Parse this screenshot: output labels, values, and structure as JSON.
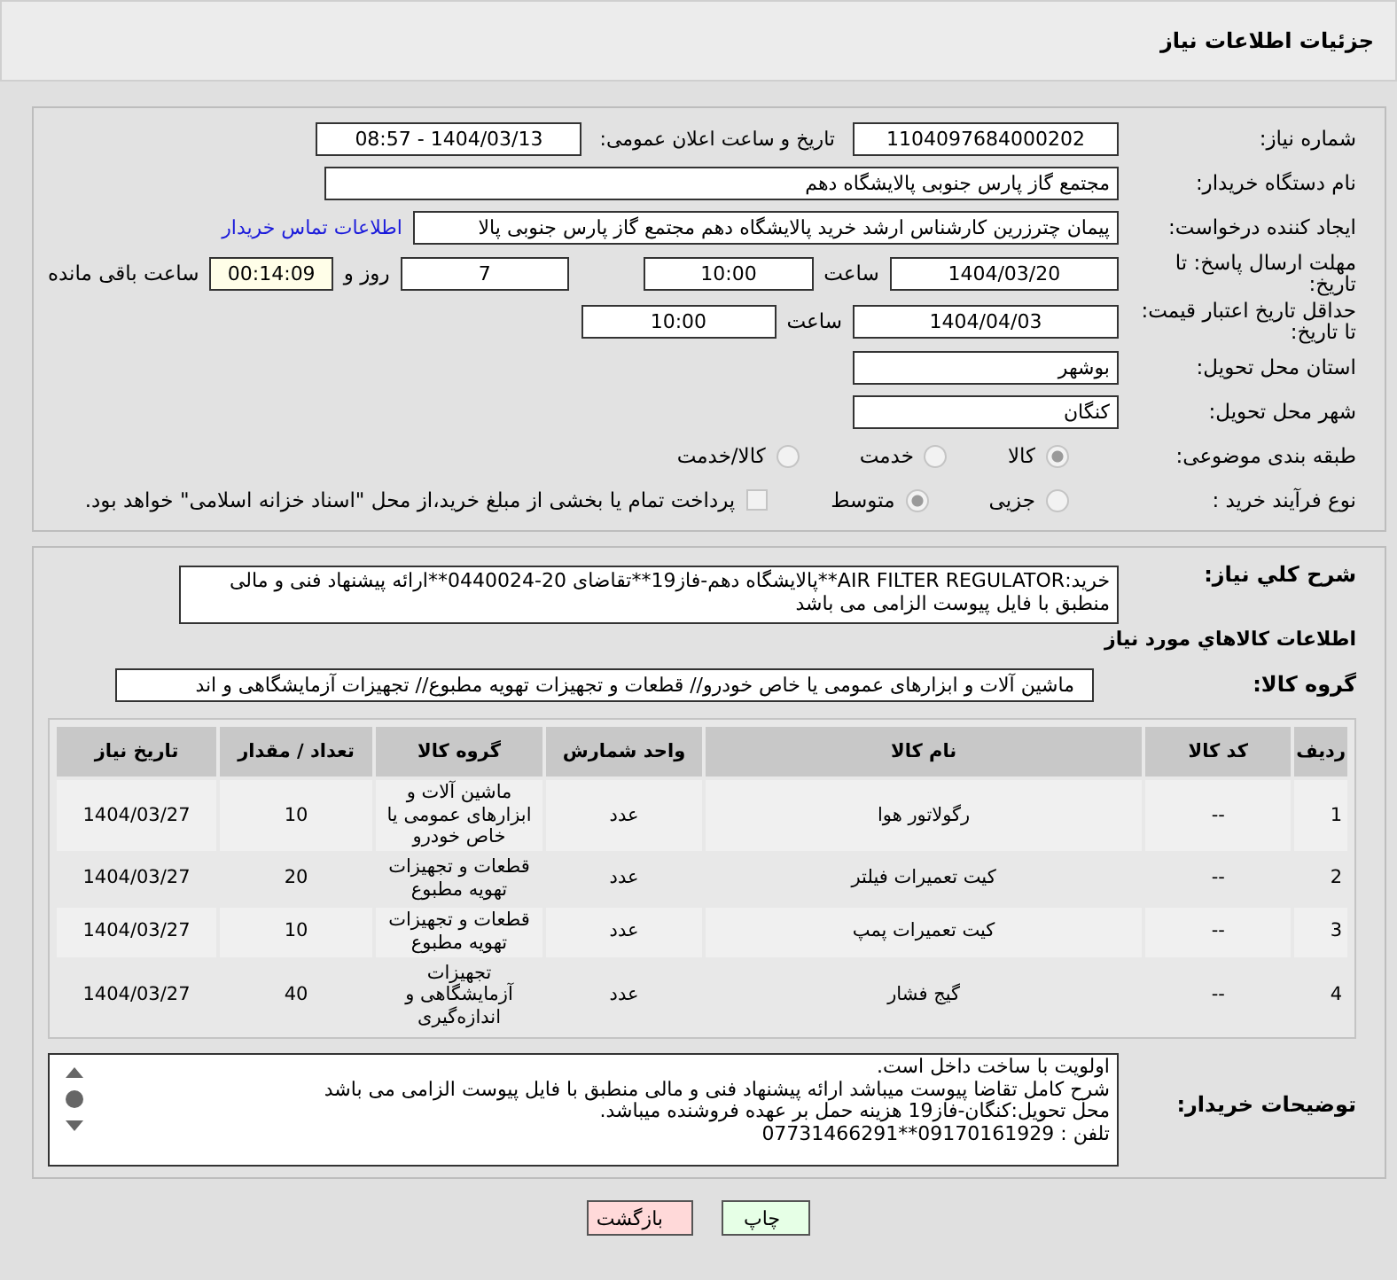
{
  "header": {
    "title": "جزئیات اطلاعات نیاز"
  },
  "need_number": {
    "label": "شماره نیاز:",
    "value": "1104097684000202"
  },
  "announce": {
    "label": "تاریخ و ساعت اعلان عمومی:",
    "value": "1404/03/13 - 08:57"
  },
  "buyer_org": {
    "label": "نام دستگاه خریدار:",
    "value": "مجتمع گاز پارس جنوبی  پالایشگاه دهم"
  },
  "requester": {
    "label": "ایجاد کننده درخواست:",
    "value": "پیمان چترزرین کارشناس ارشد خرید پالایشگاه دهم مجتمع گاز پارس جنوبی  پالا",
    "link": "اطلاعات تماس خریدار"
  },
  "reply_deadline": {
    "label": "مهلت ارسال پاسخ: تا تاریخ:",
    "date": "1404/03/20",
    "time_label": "ساعت",
    "time": "10:00",
    "days": "7",
    "days_label": "روز و",
    "remaining": "00:14:09",
    "remaining_label": "ساعت باقی مانده"
  },
  "price_validity": {
    "label": "حداقل تاریخ اعتبار قیمت: تا تاریخ:",
    "date": "1404/04/03",
    "time_label": "ساعت",
    "time": "10:00"
  },
  "province": {
    "label": "استان محل تحویل:",
    "value": "بوشهر"
  },
  "city": {
    "label": "شهر محل تحویل:",
    "value": "کنگان"
  },
  "category": {
    "label": "طبقه بندی موضوعی:",
    "options": [
      {
        "label": "کالا",
        "selected": true
      },
      {
        "label": "خدمت",
        "selected": false
      },
      {
        "label": "کالا/خدمت",
        "selected": false
      }
    ]
  },
  "purchase_type": {
    "label": "نوع فرآیند خرید :",
    "options": [
      {
        "label": "جزیی",
        "selected": false
      },
      {
        "label": "متوسط",
        "selected": true
      }
    ],
    "payment": {
      "checked": false,
      "text": "پرداخت تمام یا بخشی از مبلغ خرید،از محل \"اسناد خزانه اسلامی\" خواهد بود."
    }
  },
  "description": {
    "label": "شرح کلي نياز:",
    "value": "خرید:AIR FILTER REGULATOR**پالایشگاه دهم-فاز19**تقاضای 20-0440024**ارائه پیشنهاد فنی و مالی منطبق با فایل پیوست الزامی می باشد"
  },
  "goods_title": "اطلاعات کالاهاي مورد نياز",
  "goods_group": {
    "label": "گروه کالا:",
    "value": "ماشین آلات و ابزارهای عمومی یا خاص خودرو//  قطعات و تجهیزات تهویه مطبوع// تجهیزات آزمایشگاهی و اند"
  },
  "table": {
    "columns": [
      "ردیف",
      "کد کالا",
      "نام کالا",
      "واحد شمارش",
      "گروه کالا",
      "تعداد / مقدار",
      "تاریخ نیاز"
    ],
    "rows": [
      [
        "1",
        "--",
        "رگولاتور هوا",
        "عدد",
        "ماشین آلات و ابزارهای عمومی یا خاص خودرو",
        "10",
        "1404/03/27"
      ],
      [
        "2",
        "--",
        "کیت تعمیرات فیلتر",
        "عدد",
        "قطعات و تجهیزات تهویه مطبوع",
        "20",
        "1404/03/27"
      ],
      [
        "3",
        "--",
        "کیت تعمیرات پمپ",
        "عدد",
        "قطعات و تجهیزات تهویه مطبوع",
        "10",
        "1404/03/27"
      ],
      [
        "4",
        "--",
        "گیج فشار",
        "عدد",
        "تجهیزات آزمایشگاهی و اندازه‌گیری",
        "40",
        "1404/03/27"
      ]
    ]
  },
  "buyer_notes": {
    "label": "توضیحات خریدار:",
    "lines": [
      "اولویت با ساخت داخل است.",
      "شرح کامل تقاضا پیوست میباشد ارائه پیشنهاد فنی و مالی منطبق با فایل پیوست الزامی می باشد",
      "محل تحویل:کنگان-فاز19 هزینه حمل بر عهده فروشنده میباشد.",
      "تلفن : 09170161929**07731466291"
    ]
  },
  "buttons": [
    {
      "kind": "print",
      "label": "چاپ"
    },
    {
      "kind": "back",
      "label": "بازگشت"
    }
  ]
}
